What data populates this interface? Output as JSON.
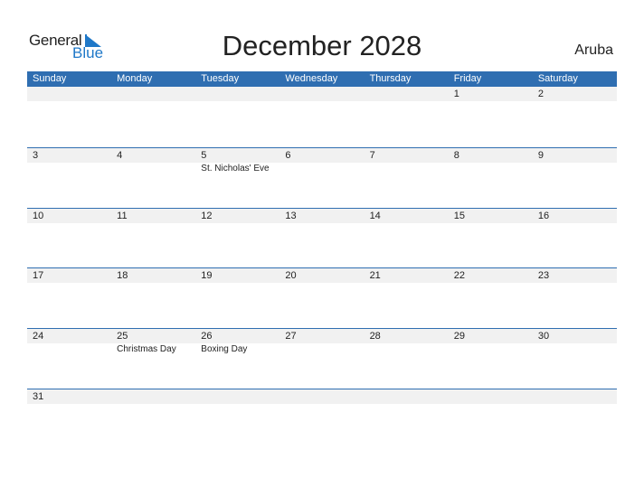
{
  "logo": {
    "general": "General",
    "blue": "Blue"
  },
  "title": "December 2028",
  "country": "Aruba",
  "weekdays": [
    "Sunday",
    "Monday",
    "Tuesday",
    "Wednesday",
    "Thursday",
    "Friday",
    "Saturday"
  ],
  "weeks": [
    [
      {
        "d": ""
      },
      {
        "d": ""
      },
      {
        "d": ""
      },
      {
        "d": ""
      },
      {
        "d": ""
      },
      {
        "d": "1"
      },
      {
        "d": "2"
      }
    ],
    [
      {
        "d": "3"
      },
      {
        "d": "4"
      },
      {
        "d": "5",
        "ev": "St. Nicholas' Eve"
      },
      {
        "d": "6"
      },
      {
        "d": "7"
      },
      {
        "d": "8"
      },
      {
        "d": "9"
      }
    ],
    [
      {
        "d": "10"
      },
      {
        "d": "11"
      },
      {
        "d": "12"
      },
      {
        "d": "13"
      },
      {
        "d": "14"
      },
      {
        "d": "15"
      },
      {
        "d": "16"
      }
    ],
    [
      {
        "d": "17"
      },
      {
        "d": "18"
      },
      {
        "d": "19"
      },
      {
        "d": "20"
      },
      {
        "d": "21"
      },
      {
        "d": "22"
      },
      {
        "d": "23"
      }
    ],
    [
      {
        "d": "24"
      },
      {
        "d": "25",
        "ev": "Christmas Day"
      },
      {
        "d": "26",
        "ev": "Boxing Day"
      },
      {
        "d": "27"
      },
      {
        "d": "28"
      },
      {
        "d": "29"
      },
      {
        "d": "30"
      }
    ],
    [
      {
        "d": "31"
      },
      {
        "d": ""
      },
      {
        "d": ""
      },
      {
        "d": ""
      },
      {
        "d": ""
      },
      {
        "d": ""
      },
      {
        "d": ""
      }
    ]
  ],
  "colors": {
    "header": "#2f6eb1",
    "brand": "#1f78c8",
    "band": "#f1f1f1"
  }
}
